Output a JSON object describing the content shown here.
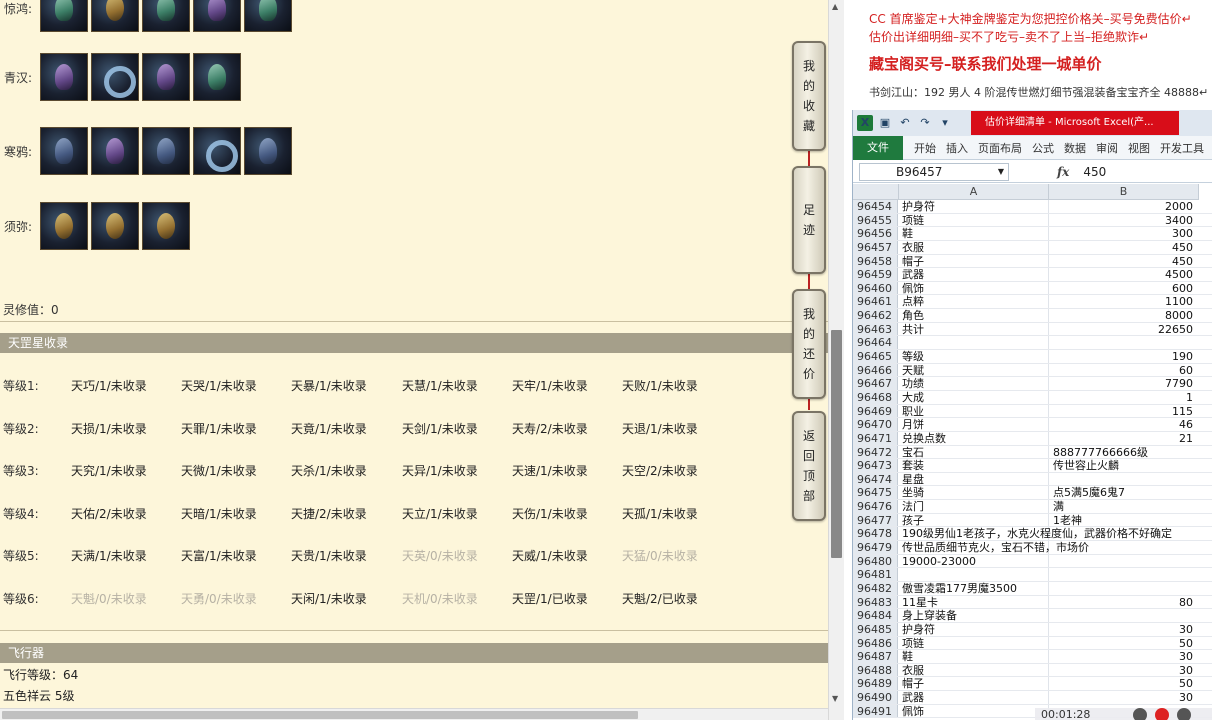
{
  "left_page": {
    "equipment": [
      {
        "label": "惊鸿:",
        "icons": [
          "green",
          "gold",
          "green",
          "purple",
          "green"
        ],
        "icon_names": [
          "boots-icon",
          "necklace-icon",
          "bracelet-icon",
          "tentacle-icon",
          "mask-icon"
        ]
      },
      {
        "label": "青汉:",
        "icons": [
          "purple",
          "ring",
          "purple",
          "green"
        ],
        "icon_names": [
          "robe-icon",
          "ring-icon",
          "cloak-icon",
          "staff-icon"
        ]
      },
      {
        "label": "寒鸦:",
        "icons": [
          "",
          "purple",
          "",
          "ring",
          ""
        ],
        "icon_names": [
          "armor-icon",
          "helmet-icon",
          "blade-icon",
          "ring-icon",
          "cloak-icon"
        ]
      },
      {
        "label": "须弥:",
        "icons": [
          "gold",
          "gold",
          "gold"
        ],
        "icon_names": [
          "amulet-icon",
          "gold-ring-icon",
          "pendant-icon"
        ]
      }
    ],
    "lingxiu": "灵修值：0",
    "tiangang_header": "天罡星收录",
    "levels": [
      {
        "label": "等级1:",
        "items": [
          {
            "t": "天巧/1/未收录",
            "dim": false
          },
          {
            "t": "天哭/1/未收录",
            "dim": false
          },
          {
            "t": "天暴/1/未收录",
            "dim": false
          },
          {
            "t": "天慧/1/未收录",
            "dim": false
          },
          {
            "t": "天牢/1/未收录",
            "dim": false
          },
          {
            "t": "天败/1/未收录",
            "dim": false
          }
        ]
      },
      {
        "label": "等级2:",
        "items": [
          {
            "t": "天损/1/未收录",
            "dim": false
          },
          {
            "t": "天罪/1/未收录",
            "dim": false
          },
          {
            "t": "天竟/1/未收录",
            "dim": false
          },
          {
            "t": "天剑/1/未收录",
            "dim": false
          },
          {
            "t": "天寿/2/未收录",
            "dim": false
          },
          {
            "t": "天退/1/未收录",
            "dim": false
          }
        ]
      },
      {
        "label": "等级3:",
        "items": [
          {
            "t": "天究/1/未收录",
            "dim": false
          },
          {
            "t": "天微/1/未收录",
            "dim": false
          },
          {
            "t": "天杀/1/未收录",
            "dim": false
          },
          {
            "t": "天异/1/未收录",
            "dim": false
          },
          {
            "t": "天速/1/未收录",
            "dim": false
          },
          {
            "t": "天空/2/未收录",
            "dim": false
          }
        ]
      },
      {
        "label": "等级4:",
        "items": [
          {
            "t": "天佑/2/未收录",
            "dim": false
          },
          {
            "t": "天暗/1/未收录",
            "dim": false
          },
          {
            "t": "天捷/2/未收录",
            "dim": false
          },
          {
            "t": "天立/1/未收录",
            "dim": false
          },
          {
            "t": "天伤/1/未收录",
            "dim": false
          },
          {
            "t": "天孤/1/未收录",
            "dim": false
          }
        ]
      },
      {
        "label": "等级5:",
        "items": [
          {
            "t": "天满/1/未收录",
            "dim": false
          },
          {
            "t": "天富/1/未收录",
            "dim": false
          },
          {
            "t": "天贵/1/未收录",
            "dim": false
          },
          {
            "t": "天英/0/未收录",
            "dim": true
          },
          {
            "t": "天威/1/未收录",
            "dim": false
          },
          {
            "t": "天猛/0/未收录",
            "dim": true
          }
        ]
      },
      {
        "label": "等级6:",
        "items": [
          {
            "t": "天魁/0/未收录",
            "dim": true
          },
          {
            "t": "天勇/0/未收录",
            "dim": true
          },
          {
            "t": "天闲/1/未收录",
            "dim": false
          },
          {
            "t": "天机/0/未收录",
            "dim": true
          },
          {
            "t": "天罡/1/已收录",
            "dim": false
          },
          {
            "t": "天魁/2/已收录",
            "dim": false
          }
        ]
      }
    ],
    "flyer_header": "飞行器",
    "flyer_level": "飞行等级：64",
    "wuse": "五色祥云   5级",
    "nav_buttons": [
      {
        "name": "favorites",
        "chars": [
          "我",
          "的",
          "收",
          "藏"
        ]
      },
      {
        "name": "footprints",
        "chars": [
          "足",
          "迹"
        ]
      },
      {
        "name": "my-offers",
        "chars": [
          "我",
          "的",
          "还",
          "价"
        ]
      },
      {
        "name": "back-to-top",
        "chars": [
          "返",
          "回",
          "顶",
          "部"
        ]
      }
    ]
  },
  "notes": {
    "line1": "CC 首席鉴定+大神金牌鉴定为您把控价格关–买号免费估价↵",
    "line2": "估价出详细明细–买不了吃亏–卖不了上当–拒绝欺诈↵",
    "line3": "藏宝阁买号–联系我们处理一城单价",
    "line4": "书剑江山：192 男人 4 阶混传世燃灯细节强混装备宝宝齐全 48888↵"
  },
  "excel": {
    "title": "估价详细清单 - Microsoft Excel(产...",
    "file_tab": "文件",
    "tabs": [
      "开始",
      "插入",
      "页面布局",
      "公式",
      "数据",
      "审阅",
      "视图",
      "开发工具"
    ],
    "namebox": "B96457",
    "formula_value": "450",
    "col_a": "A",
    "col_b": "B",
    "rows": [
      {
        "n": "96454",
        "a": "护身符",
        "b": "2000"
      },
      {
        "n": "96455",
        "a": "项链",
        "b": "3400"
      },
      {
        "n": "96456",
        "a": "鞋",
        "b": "300"
      },
      {
        "n": "96457",
        "a": "衣服",
        "b": "450"
      },
      {
        "n": "96458",
        "a": "帽子",
        "b": "450"
      },
      {
        "n": "96459",
        "a": "武器",
        "b": "4500"
      },
      {
        "n": "96460",
        "a": "佩饰",
        "b": "600"
      },
      {
        "n": "96461",
        "a": "点粹",
        "b": "1100"
      },
      {
        "n": "96462",
        "a": "角色",
        "b": "8000"
      },
      {
        "n": "96463",
        "a": "共计",
        "b": "22650"
      },
      {
        "n": "96464",
        "a": "",
        "b": ""
      },
      {
        "n": "96465",
        "a": "等级",
        "b": "190"
      },
      {
        "n": "96466",
        "a": "天赋",
        "b": "60"
      },
      {
        "n": "96467",
        "a": "功绩",
        "b": "7790"
      },
      {
        "n": "96468",
        "a": "大成",
        "b": "1"
      },
      {
        "n": "96469",
        "a": "职业",
        "b": "115"
      },
      {
        "n": "96470",
        "a": "月饼",
        "b": "46"
      },
      {
        "n": "96471",
        "a": "兑换点数",
        "b": "21"
      },
      {
        "n": "96472",
        "a": "宝石",
        "bt": "888777766666级"
      },
      {
        "n": "96473",
        "a": "套装",
        "bt": "传世容止火麟"
      },
      {
        "n": "96474",
        "a": "星盘",
        "b": ""
      },
      {
        "n": "96475",
        "a": "坐骑",
        "bt": "点5满5魔6鬼7"
      },
      {
        "n": "96476",
        "a": "法门",
        "bt": "满"
      },
      {
        "n": "96477",
        "a": "孩子",
        "bt": "1老神"
      },
      {
        "n": "96478",
        "a": "190级男仙1老孩子，水克火程度仙，武器价格不好确定",
        "b": ""
      },
      {
        "n": "96479",
        "a": "传世品质细节克火，宝石不错，市场价",
        "b": ""
      },
      {
        "n": "96480",
        "a": "19000-23000",
        "b": ""
      },
      {
        "n": "96481",
        "a": "",
        "b": ""
      },
      {
        "n": "96482",
        "a": "傲雪凌霜177男魔3500",
        "b": ""
      },
      {
        "n": "96483",
        "a": "11星卡",
        "b": "80"
      },
      {
        "n": "96484",
        "a": "身上穿装备",
        "b": ""
      },
      {
        "n": "96485",
        "a": "护身符",
        "b": "30"
      },
      {
        "n": "96486",
        "a": "项链",
        "b": "50"
      },
      {
        "n": "96487",
        "a": "鞋",
        "b": "30"
      },
      {
        "n": "96488",
        "a": "衣服",
        "b": "30"
      },
      {
        "n": "96489",
        "a": "帽子",
        "b": "50"
      },
      {
        "n": "96490",
        "a": "武器",
        "b": "30"
      },
      {
        "n": "96491",
        "a": "佩饰",
        "b": ""
      }
    ]
  },
  "player": {
    "time": "00:01:28"
  },
  "colors": {
    "page_bg": "#fdf6da",
    "section_header": "#a59f8a",
    "note_red": "#d42020",
    "excel_green": "#1f7a3e",
    "title_red": "#d80d19"
  }
}
